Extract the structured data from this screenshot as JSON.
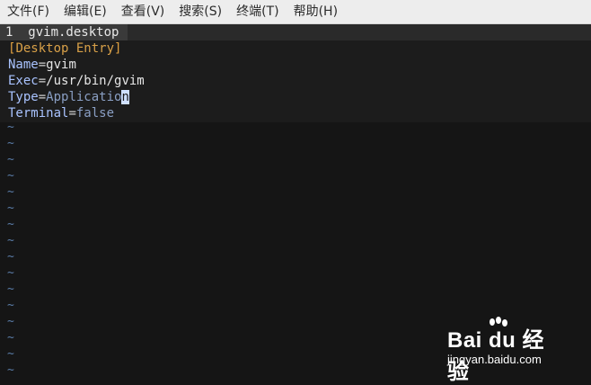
{
  "menubar": {
    "items": [
      "文件(F)",
      "编辑(E)",
      "查看(V)",
      "搜索(S)",
      "终端(T)",
      "帮助(H)"
    ]
  },
  "tab": {
    "label": "1  gvim.desktop"
  },
  "editor": {
    "section_open": "[",
    "section_name": "Desktop Entry",
    "section_close": "]",
    "lines": [
      {
        "key": "Name",
        "eq": "=",
        "value": "gvim"
      },
      {
        "key": "Exec",
        "eq": "=",
        "value": "/usr/bin/gvim"
      },
      {
        "key": "Type",
        "eq": "=",
        "value_before_cursor": "Applicatio",
        "cursor_char": "n"
      },
      {
        "key": "Terminal",
        "eq": "=",
        "value": "false"
      }
    ],
    "empty_line_marker": "~"
  },
  "watermark": {
    "logo": "Bai du 经验",
    "url": "jingyan.baidu.com"
  },
  "colors": {
    "background": "#151515",
    "menubar": "#ededed",
    "section": "#d8a048",
    "key": "#a9c3ff",
    "tilde": "#5a7ca8"
  }
}
